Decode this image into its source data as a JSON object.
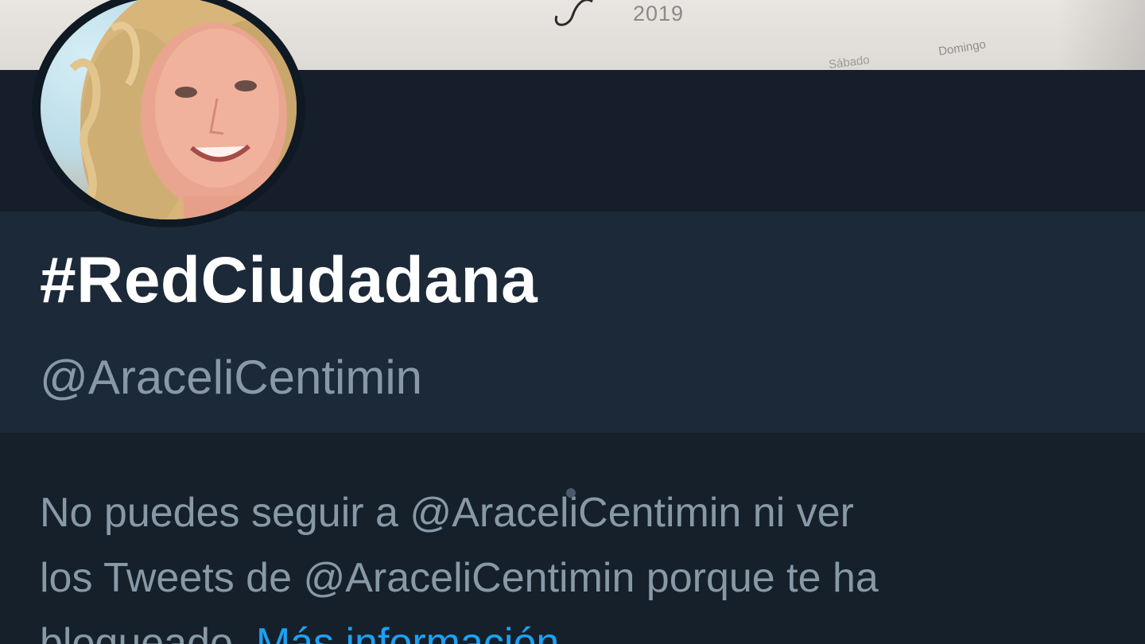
{
  "banner": {
    "year": "2019",
    "day_left": "Sábado",
    "day_right": "Domingo"
  },
  "profile": {
    "display_name": "#RedCiudadana",
    "handle": "@AraceliCentimin"
  },
  "blocked": {
    "line1": "No puedes seguir a @AraceliCentimin ni ver",
    "line2": "los Tweets de @AraceliCentimin porque te ha",
    "line3_prefix": "bloqueado. ",
    "more_link": "Más información"
  },
  "colors": {
    "background": "#15202b",
    "profile_band": "#1c2938",
    "secondary_text": "#8899a6",
    "link": "#1da1f2"
  }
}
